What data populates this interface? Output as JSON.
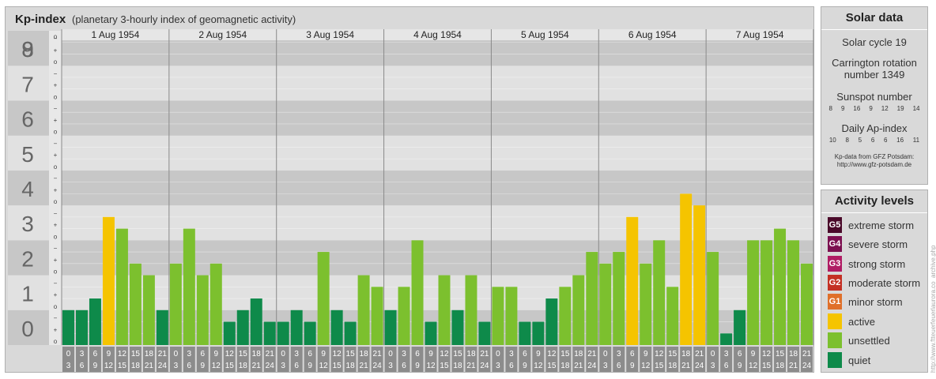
{
  "header": {
    "title": "Kp-index",
    "subtitle": "(planetary 3-hourly index of geomagnetic activity)"
  },
  "solar": {
    "header": "Solar data",
    "cycle": "Solar cycle 19",
    "carrington_line1": "Carrington rotation",
    "carrington_line2": "number 1349",
    "sunspot_label": "Sunspot number",
    "sunspot_values": [
      "8",
      "9",
      "16",
      "9",
      "12",
      "19",
      "14"
    ],
    "ap_label": "Daily Ap-index",
    "ap_values": [
      "10",
      "8",
      "5",
      "6",
      "6",
      "16",
      "11"
    ],
    "credit_line1": "Kp-data from GFZ Potsdam:",
    "credit_line2": "http://www.gfz-potsdam.de"
  },
  "activity": {
    "header": "Activity levels",
    "items": [
      {
        "code": "G5",
        "label": "extreme storm",
        "color": "#4a0a2a"
      },
      {
        "code": "G4",
        "label": "severe storm",
        "color": "#7c1050"
      },
      {
        "code": "G3",
        "label": "strong storm",
        "color": "#b01c64"
      },
      {
        "code": "G2",
        "label": "moderate storm",
        "color": "#c43024"
      },
      {
        "code": "G1",
        "label": "minor storm",
        "color": "#e0702a"
      },
      {
        "code": "",
        "label": "active",
        "color": "#f5c400"
      },
      {
        "code": "",
        "label": "unsettled",
        "color": "#7cc02e"
      },
      {
        "code": "",
        "label": "quiet",
        "color": "#0e8a4a"
      }
    ]
  },
  "watermark": "http://www.ftteuerfeuerlaurora.co_archive.php",
  "chart_data": {
    "type": "bar",
    "y_ticks": [
      "0",
      "1",
      "2",
      "3",
      "4",
      "5",
      "6",
      "7",
      "8",
      "9"
    ],
    "ylim": [
      0,
      9
    ],
    "sub_tick_labels": [
      "o",
      "+",
      "−"
    ],
    "days": [
      "1 Aug 1954",
      "2 Aug 1954",
      "3 Aug 1954",
      "4 Aug 1954",
      "5 Aug 1954",
      "6 Aug 1954",
      "7 Aug 1954"
    ],
    "hour_starts": [
      "0",
      "3",
      "6",
      "9",
      "12",
      "15",
      "18",
      "21"
    ],
    "hour_ends": [
      "3",
      "6",
      "9",
      "12",
      "15",
      "18",
      "21",
      "24"
    ],
    "values": [
      1.0,
      1.0,
      1.333,
      3.667,
      3.333,
      2.333,
      2.0,
      1.0,
      2.333,
      3.333,
      2.0,
      2.333,
      0.667,
      1.0,
      1.333,
      0.667,
      0.667,
      1.0,
      0.667,
      2.667,
      1.0,
      0.667,
      2.0,
      1.667,
      1.0,
      1.667,
      3.0,
      0.667,
      2.0,
      1.0,
      2.0,
      0.667,
      1.667,
      1.667,
      0.667,
      0.667,
      1.333,
      1.667,
      2.0,
      2.667,
      2.333,
      2.667,
      3.667,
      2.333,
      3.0,
      1.667,
      4.333,
      4.0,
      2.667,
      0.333,
      1.0,
      3.0,
      3.0,
      3.333,
      3.0,
      2.333
    ],
    "colors": {
      "quiet": "#0e8a4a",
      "unsettled": "#7cc02e",
      "active": "#f5c400",
      "band_dark": "#c7c7c7",
      "band_light": "#e1e1e1",
      "axis_box": "#8c8c8c",
      "axis_label": "#ffffff"
    }
  }
}
